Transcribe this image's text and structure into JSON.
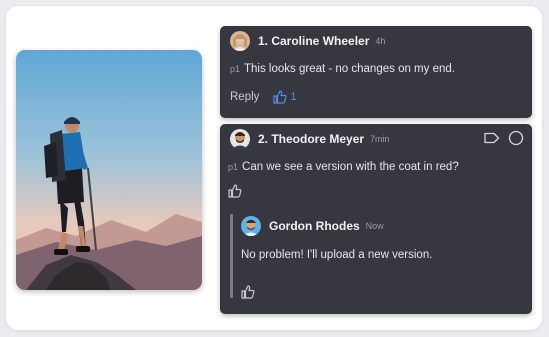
{
  "photo": {
    "alt_icon": "hiker-photo"
  },
  "comments": [
    {
      "index_name": "1. Caroline Wheeler",
      "time": "4h",
      "tag": "p1",
      "text": "This looks great - no changes on my end.",
      "reply_label": "Reply",
      "likes": "1",
      "liked": true
    },
    {
      "index_name": "2. Theodore Meyer",
      "time": "7min",
      "tag": "p1",
      "text": "Can we see a version with the coat in red?",
      "icons": [
        "label-icon",
        "resolve-circle-icon"
      ],
      "reply": {
        "name": "Gordon Rhodes",
        "time": "Now",
        "text": "No problem! I'll upload a new version."
      }
    }
  ],
  "colors": {
    "card_bg": "#36373f",
    "accent": "#4d8ef7",
    "muted": "#9a9ba6"
  }
}
